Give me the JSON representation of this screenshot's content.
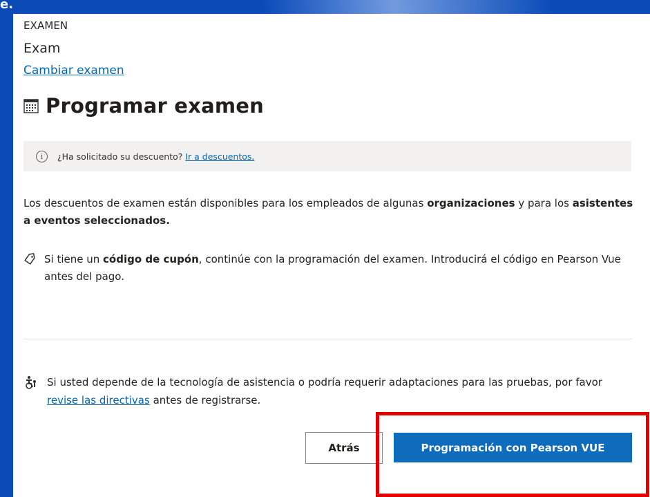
{
  "page": {
    "corner_text": "e."
  },
  "exam": {
    "section_label": "EXAMEN",
    "name": "Exam",
    "change_link": "Cambiar examen"
  },
  "schedule": {
    "title": "Programar examen",
    "title_icon": "calendar-icon"
  },
  "info_bar": {
    "icon": "info-icon",
    "text": "¿Ha solicitado su descuento?",
    "link": "Ir a descuentos."
  },
  "discounts": {
    "p1_a": "Los descuentos de examen están disponibles para los empleados de algunas ",
    "p1_b": "organizaciones",
    "p1_c": " y para los ",
    "p1_d": "asistentes a eventos seleccionados."
  },
  "coupon": {
    "icon": "tag-icon",
    "t1": "Si tiene un ",
    "t2": "código de cupón",
    "t3": ", continúe con la programación del examen. Introducirá el código en Pearson Vue antes del pago."
  },
  "accessibility": {
    "icon": "accessibility-icon",
    "t1": "Si usted depende de la tecnología de asistencia o podría requerir adaptaciones para las pruebas, por favor ",
    "link": "revise las directivas",
    "t2": " antes de registrarse."
  },
  "buttons": {
    "back": "Atrás",
    "primary": "Programación con Pearson VUE"
  },
  "colors": {
    "background": "#0a4bb8",
    "link": "#0067b8",
    "primary": "#0f6cbd",
    "highlight": "#e00000"
  }
}
